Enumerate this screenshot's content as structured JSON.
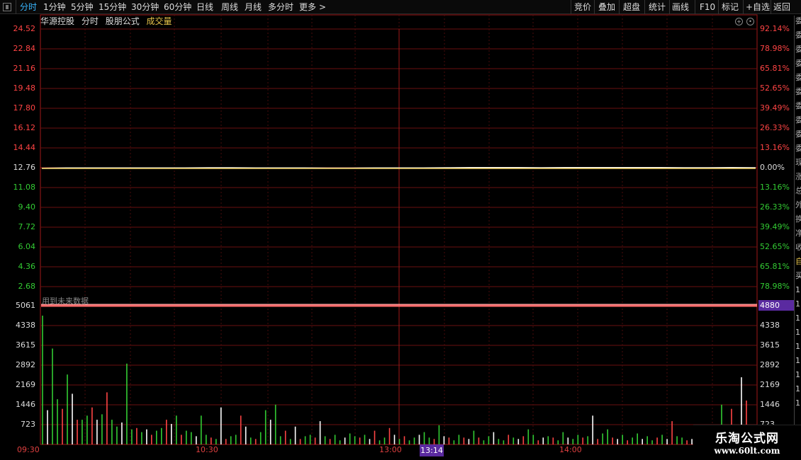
{
  "toolbar": {
    "left_items": [
      "分时",
      "1分钟",
      "5分钟",
      "15分钟",
      "30分钟",
      "60分钟",
      "日线",
      "周线",
      "月线",
      "多分时",
      "更多 >"
    ],
    "right_items": [
      "竞价",
      "叠加",
      "超盘",
      "统计",
      "画线",
      "F10",
      "标记",
      "+自选",
      "返回"
    ],
    "active_index": 0
  },
  "header": {
    "stock_name": "华源控股",
    "tab_label": "分时",
    "formula_label": "股朋公式",
    "volume_label": "成交量"
  },
  "price_axis": {
    "left": [
      "24.52",
      "22.84",
      "21.16",
      "19.48",
      "17.80",
      "16.12",
      "14.44",
      "12.76",
      "11.08",
      "9.40",
      "7.72",
      "6.04",
      "4.36",
      "2.68"
    ],
    "right": [
      "92.14%",
      "78.98%",
      "65.81%",
      "52.65%",
      "39.49%",
      "26.33%",
      "13.16%",
      "0.00%",
      "13.16%",
      "26.33%",
      "39.49%",
      "52.65%",
      "65.81%",
      "78.98%"
    ],
    "colors": {
      "up": "#ff4444",
      "flat": "#dddddd",
      "down": "#33cc33"
    }
  },
  "volume_axis": {
    "left": [
      "5061",
      "4338",
      "3615",
      "2892",
      "2169",
      "1446",
      "723"
    ],
    "right": [
      "4338",
      "3615",
      "2892",
      "2169",
      "1446",
      "723"
    ],
    "cursor_value": "4880"
  },
  "time_axis": {
    "labels": [
      "09:30",
      "10:30",
      "13:00",
      "14:00"
    ],
    "cursor_label": "13:14"
  },
  "future_data_note": "用到未来数据",
  "right_strip_chars": [
    "委",
    "委",
    "委",
    "委",
    "委",
    "委",
    "委",
    "委",
    "委",
    "委",
    "现",
    "涨",
    "总",
    "外",
    "换",
    "净",
    "收",
    "自",
    "买",
    "1",
    "1",
    "1",
    "1",
    "1",
    "1",
    "1",
    "1",
    "1"
  ],
  "watermark": {
    "name": "乐淘公式网",
    "url": "www.60lt.com"
  },
  "chart_data": {
    "type": "line",
    "series": [
      {
        "values": [
          12.72,
          12.74,
          12.75,
          12.75,
          12.74,
          12.74,
          12.75,
          12.76,
          12.76,
          12.75,
          12.74,
          12.74,
          12.73,
          12.73,
          12.74,
          12.75,
          12.75,
          12.76,
          12.77,
          12.77,
          12.77,
          12.76,
          12.77,
          12.77,
          12.77,
          12.77,
          12.77,
          12.76,
          12.76,
          12.77,
          12.76
        ]
      }
    ],
    "ylim": [
      1.0,
      24.52
    ],
    "volume": {
      "values": [
        4700,
        1250,
        3500,
        1650,
        1300,
        2550,
        1850,
        900,
        900,
        1050,
        1350,
        900,
        1100,
        1900,
        900,
        650,
        800,
        2950,
        550,
        600,
        450,
        550,
        350,
        500,
        600,
        900,
        750,
        1050,
        350,
        500,
        450,
        300,
        1050,
        350,
        250,
        200,
        1350,
        200,
        300,
        350,
        1050,
        650,
        250,
        200,
        450,
        1250,
        900,
        1450,
        300,
        500,
        200,
        650,
        200,
        300,
        350,
        250,
        850,
        300,
        200,
        350,
        150,
        250,
        400,
        300,
        250,
        350,
        200,
        500,
        150,
        250,
        600,
        350,
        200,
        300,
        150,
        250,
        350,
        450,
        250,
        200,
        700,
        300,
        250,
        150,
        350,
        250,
        200,
        500,
        250,
        150,
        300,
        450,
        200,
        150,
        350,
        250,
        200,
        300,
        550,
        350,
        150,
        250,
        300,
        250,
        150,
        450,
        250,
        200,
        350,
        250,
        300,
        1050,
        200,
        400,
        550,
        250,
        200,
        350,
        150,
        250,
        400,
        200,
        300,
        150,
        250,
        350,
        200,
        850,
        300,
        250,
        150,
        200,
        250,
        350,
        200,
        300,
        150,
        1450,
        250,
        1300,
        500,
        2450,
        1600,
        450
      ],
      "ylim": [
        0,
        5061
      ]
    }
  }
}
